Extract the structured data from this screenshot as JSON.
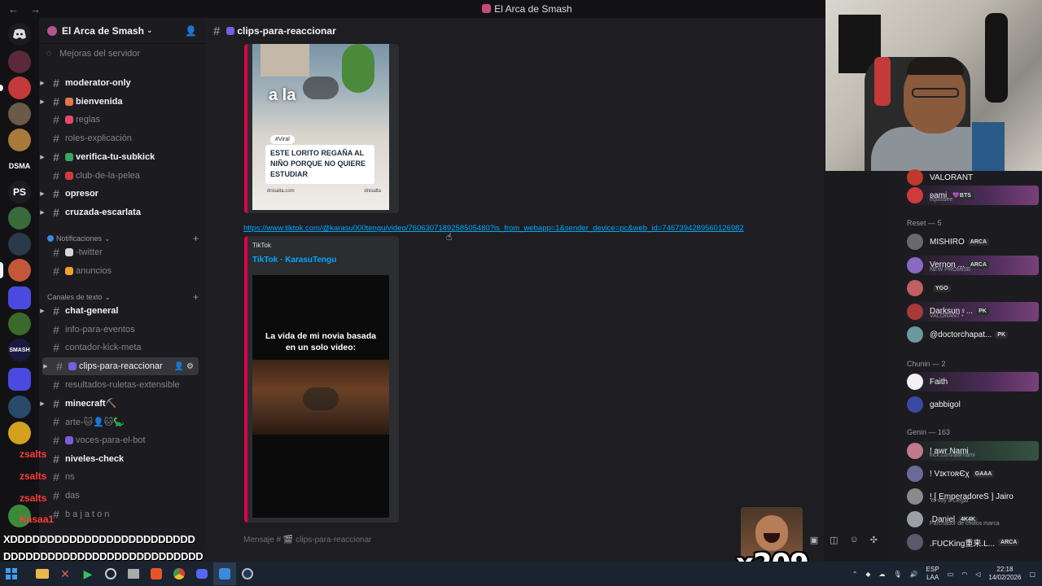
{
  "window": {
    "title": "El Arca de Smash",
    "back": "←",
    "forward": "→"
  },
  "server": {
    "name": "El Arca de Smash",
    "chevron": "⌄",
    "boost": "Mejoras del servidor"
  },
  "channels": [
    {
      "label": "moderator-only",
      "bold": true,
      "arrow": true
    },
    {
      "label": "bienvenida",
      "bold": true,
      "arrow": true,
      "emoji": "#e8734a"
    },
    {
      "label": "reglas",
      "bold": false,
      "emoji": "#e24a6a"
    },
    {
      "label": "roles-explicación",
      "bold": false
    },
    {
      "label": "verifica-tu-subkick",
      "bold": true,
      "arrow": true,
      "emoji": "#3ba55d"
    },
    {
      "label": "club-de-la-pelea",
      "bold": false,
      "emoji": "#d23c3c"
    },
    {
      "label": "opresor",
      "bold": true,
      "arrow": true
    },
    {
      "label": "cruzada-escarlata",
      "bold": true,
      "arrow": true
    }
  ],
  "categories": {
    "notificaciones": "Notificaciones",
    "canales_texto": "Canales de texto"
  },
  "notif_channels": [
    {
      "label": "-twitter",
      "emoji": "#d6d6d6"
    },
    {
      "label": "anuncios",
      "emoji": "#f0a030"
    }
  ],
  "text_channels": [
    {
      "label": "chat-general",
      "bold": true,
      "arrow": true
    },
    {
      "label": "info-para-eventos",
      "bold": false
    },
    {
      "label": "contador-kick-meta",
      "bold": false
    },
    {
      "label": "clips-para-reaccionar",
      "bold": false,
      "active": true,
      "arrow": true,
      "emoji": "#7a5ce0"
    },
    {
      "label": "resultados-ruletas-extensible",
      "bold": false
    },
    {
      "label": "minecraft⛏️",
      "bold": true,
      "arrow": true
    },
    {
      "label": "arte-🐱👤🐱🦕",
      "bold": false
    },
    {
      "label": "voces-para-el-bot",
      "bold": false,
      "emoji": "#7a5ce0"
    },
    {
      "label": "niveles-check",
      "bold": true
    },
    {
      "label": "ns",
      "bold": false
    },
    {
      "label": "das",
      "bold": false
    },
    {
      "label": "b a j a t o n",
      "bold": false
    }
  ],
  "chat": {
    "channel_title": "clips-para-reaccionar",
    "embed1": {
      "viral_tag": "#Viral",
      "caption": "ESTE LORITO REGAÑA AL NIÑO PORQUE NO QUIERE ESTUDIAR",
      "footer_left": "dnisalta.com",
      "footer_right": "dnisalta",
      "overlay_text": "a la"
    },
    "link": "https://www.tiktok.com/@karasu000tengu/video/7606307189258505480?is_from_webapp=1&sender_device=pc&web_id=7467394289560126982",
    "embed2": {
      "provider": "TikTok",
      "author": "TikTok · KarasuTengu",
      "caption_line1": "La vida de mi novia basada",
      "caption_line2": "en un solo video:"
    },
    "input_placeholder": "Mensaje # 🎬 clips-para-reaccionar"
  },
  "stream_overlay": {
    "names": [
      "zsalts",
      "zsalts",
      "zsalts",
      "Kasaa1"
    ],
    "xd_line1": "XDDDDDDDDDDDDDDDDDDDDDDDDD",
    "xd_line2": "DDDDDDDDDDDDDDDDDDDDDDDDDDD",
    "emote_count": "x209"
  },
  "members": {
    "top": [
      {
        "name": "VALORANT",
        "sub": "",
        "color": "#c0392b",
        "banner": false,
        "small": true
      },
      {
        "name": "ʚami",
        "sub": "equisdee",
        "badge": "💜BTS",
        "color": "#d03a3a",
        "banner": true
      }
    ],
    "reset_header": "Reset — 5",
    "reset": [
      {
        "name": "MISHIRO",
        "badge": "ARCA",
        "color": "#6a6a6a"
      },
      {
        "name": "Vernon ...",
        "sub": "NEW PROMISE",
        "badge": "ARCA",
        "color": "#8a6ac0",
        "banner": true
      },
      {
        "name": "",
        "badge": "YGO",
        "color": "#c06060"
      },
      {
        "name": "Darksun♀...",
        "sub": "VALORANT •",
        "badge": "PK",
        "color": "#a83a3a",
        "banner": true
      },
      {
        "name": "@doctorchapat...",
        "sub": "",
        "badge": "PK",
        "color": "#6a9aa0"
      }
    ],
    "chunin_header": "Chunin — 2",
    "chunin": [
      {
        "name": "Faith",
        "color": "#f2f2f2",
        "banner": true
      },
      {
        "name": "gabbigol",
        "color": "#3a4aa0"
      }
    ],
    "genin_header": "Genin — 163",
    "genin": [
      {
        "name": "! awr Nami",
        "sub": "kick.com/awrnami",
        "color": "#c07a8a",
        "banner2": true
      },
      {
        "name": "! VɪᴋᴛᴏʀЄχ",
        "badge": "GAAA",
        "color": "#6a6a9a"
      },
      {
        "name": "! [ EmperadoreS ] Jairo",
        "sub": "Yo voy a Llegar",
        "color": "#8a8a8a"
      },
      {
        "name": ".Daniel",
        "sub": "Parchador de cholos marca",
        "badge": "4K4K",
        "color": "#9aa0a6"
      },
      {
        "name": ".FUCKing重来.L...",
        "badge": "ARCA",
        "color": "#5a5a6a"
      }
    ]
  },
  "taskbar": {
    "lang_top": "ESP",
    "lang_bottom": "LAA",
    "time": "22:18",
    "date": "14/02/2026"
  }
}
